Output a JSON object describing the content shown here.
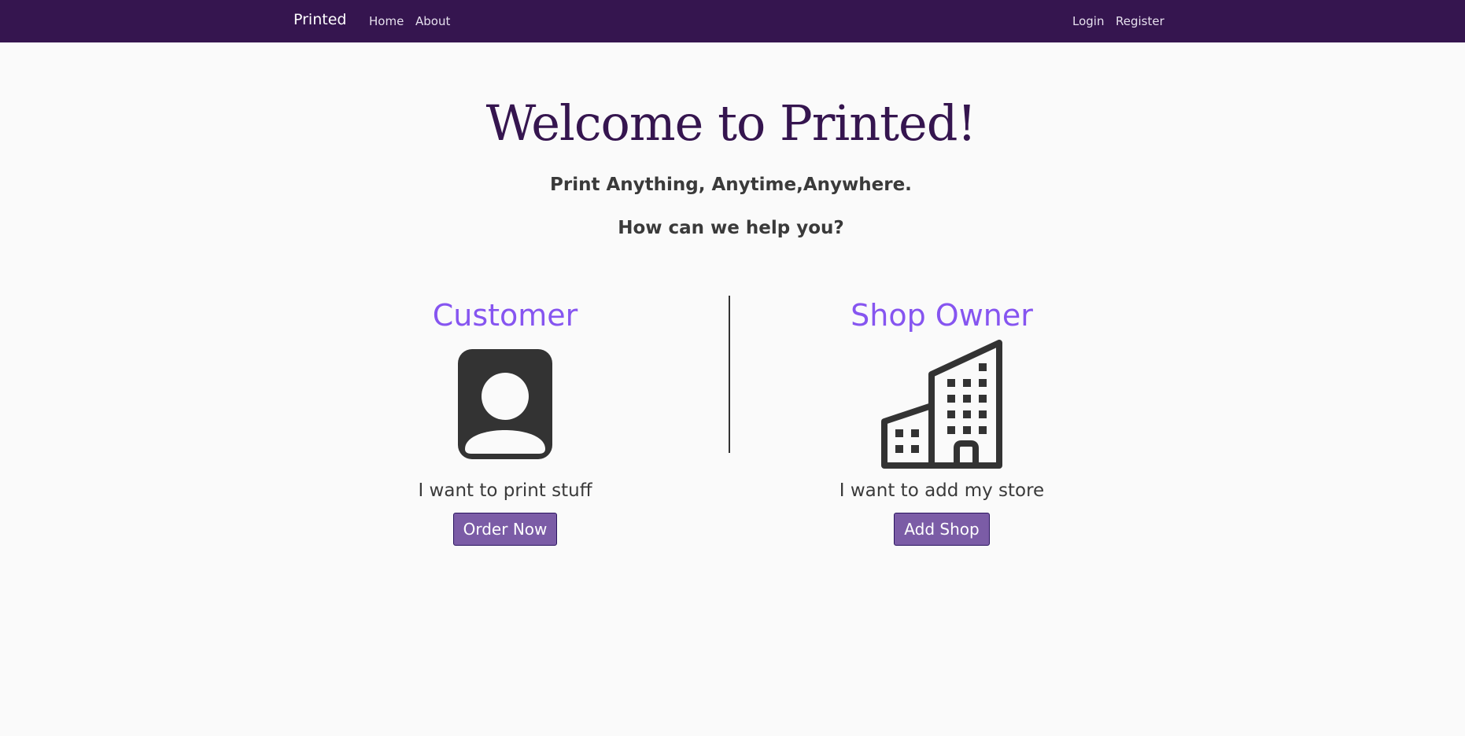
{
  "nav": {
    "brand": "Printed",
    "links": [
      "Home",
      "About"
    ],
    "auth": [
      "Login",
      "Register"
    ]
  },
  "hero": {
    "title": "Welcome to Printed!",
    "tagline": "Print Anything, Anytime,Anywhere.",
    "question": "How can we help you?"
  },
  "options": [
    {
      "title": "Customer",
      "icon": "person-icon",
      "text": "I want to print stuff",
      "button": "Order Now"
    },
    {
      "title": "Shop Owner",
      "icon": "building-icon",
      "text": "I want to add my store",
      "button": "Add Shop"
    }
  ],
  "colors": {
    "navbar": "#35154f",
    "heading": "#35154f",
    "accent": "#8655f0",
    "button": "#7b5ca6"
  }
}
